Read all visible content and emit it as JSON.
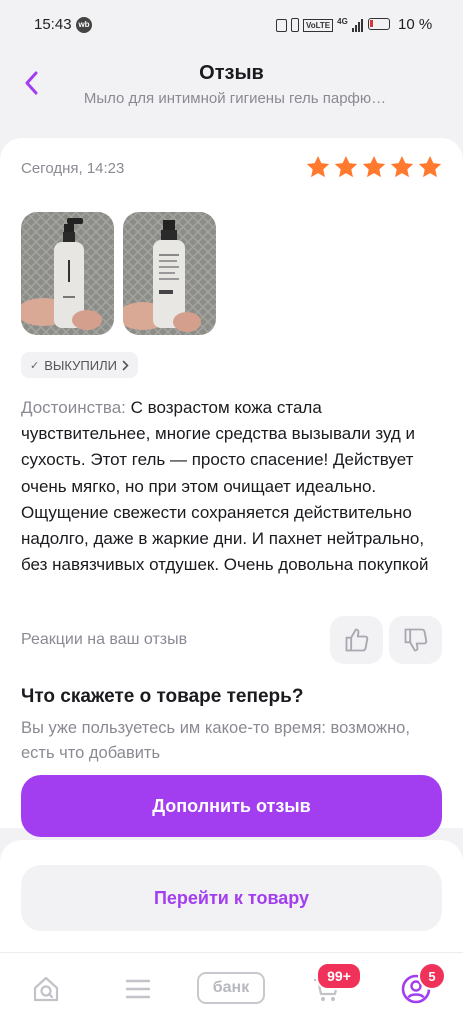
{
  "status_bar": {
    "time": "15:43",
    "app_badge": "wb",
    "network": "4G",
    "volte": "VoLTE",
    "battery": "10 %"
  },
  "header": {
    "title": "Отзыв",
    "subtitle": "Мыло для интимной гигиены гель парфю…"
  },
  "review": {
    "date": "Сегодня, 14:23",
    "rating": 5,
    "badge_label": "ВЫКУПИЛИ",
    "pros_label": "Достоинства:",
    "pros_text": "С возрастом кожа стала чувствительнее, многие средства вызывали зуд и сухость. Этот гель — просто спасение! Действует очень мягко, но при этом очищает идеально. Ощущение свежести сохраняется действительно надолго, даже в жаркие дни. И пахнет нейтрально, без навязчивых отдушек. Очень довольна покупкой",
    "reactions_label": "Реакции на ваш отзыв"
  },
  "prompt": {
    "title": "Что скажете о товаре теперь?",
    "text": "Вы уже пользуетесь им какое-то время: возможно, есть что добавить",
    "primary_button": "Дополнить отзыв"
  },
  "secondary_button": "Перейти к товару",
  "tabbar": {
    "bank_label": "банк",
    "cart_badge": "99+",
    "profile_badge": "5"
  },
  "colors": {
    "accent": "#a33df0",
    "star": "#ff7a2e",
    "badge": "#f0325a"
  }
}
